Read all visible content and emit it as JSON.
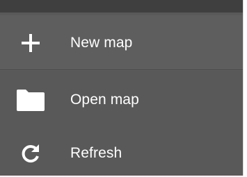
{
  "menu": {
    "items": [
      {
        "label": "New map",
        "icon": "plus-icon"
      },
      {
        "label": "Open map",
        "icon": "folder-icon"
      },
      {
        "label": "Refresh",
        "icon": "refresh-icon"
      }
    ]
  },
  "colors": {
    "background": "#595959",
    "topbar": "#3f3f3f",
    "text": "#ffffff"
  }
}
